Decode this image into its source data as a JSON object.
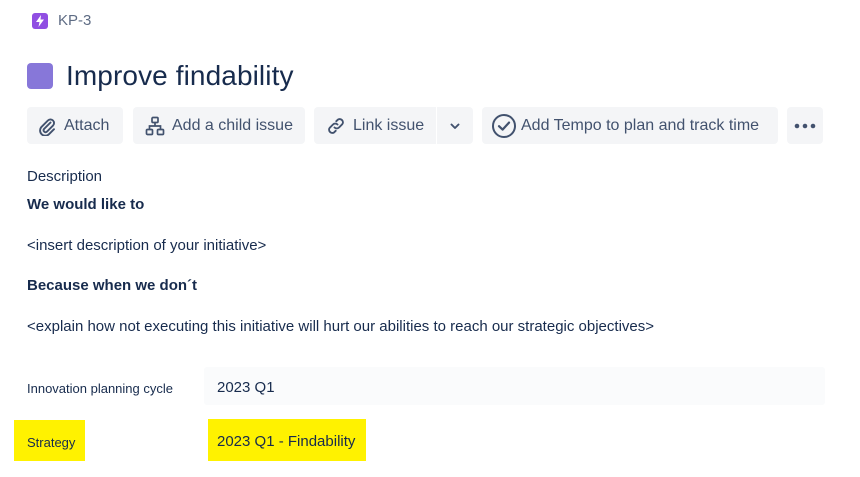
{
  "issue": {
    "key": "KP-3",
    "title": "Improve findability"
  },
  "toolbar": {
    "attach": "Attach",
    "add_child": "Add a child issue",
    "link_issue": "Link issue",
    "tempo": "Add Tempo to plan and track time"
  },
  "description": {
    "label": "Description",
    "heading1": "We would like to",
    "text1": "<insert description of your initiative>",
    "heading2": "Because when we don´t",
    "text2": "<explain how not executing this initiative will hurt our abilities to reach our strategic objectives>"
  },
  "fields": [
    {
      "label": "Innovation planning cycle",
      "value": "2023 Q1"
    },
    {
      "label": "Strategy",
      "value": "2023 Q1 - Findability"
    }
  ],
  "colors": {
    "issue_type": "#904ee2",
    "title_swatch": "#8777d9",
    "highlight": "#fff200",
    "button_bg": "#f4f5f7"
  },
  "icons": {
    "issue_type": "lightning-icon",
    "attach": "paperclip-icon",
    "child": "hierarchy-icon",
    "link": "link-icon",
    "dropdown": "chevron-down-icon",
    "tempo": "check-circle-icon",
    "more": "more-icon"
  }
}
